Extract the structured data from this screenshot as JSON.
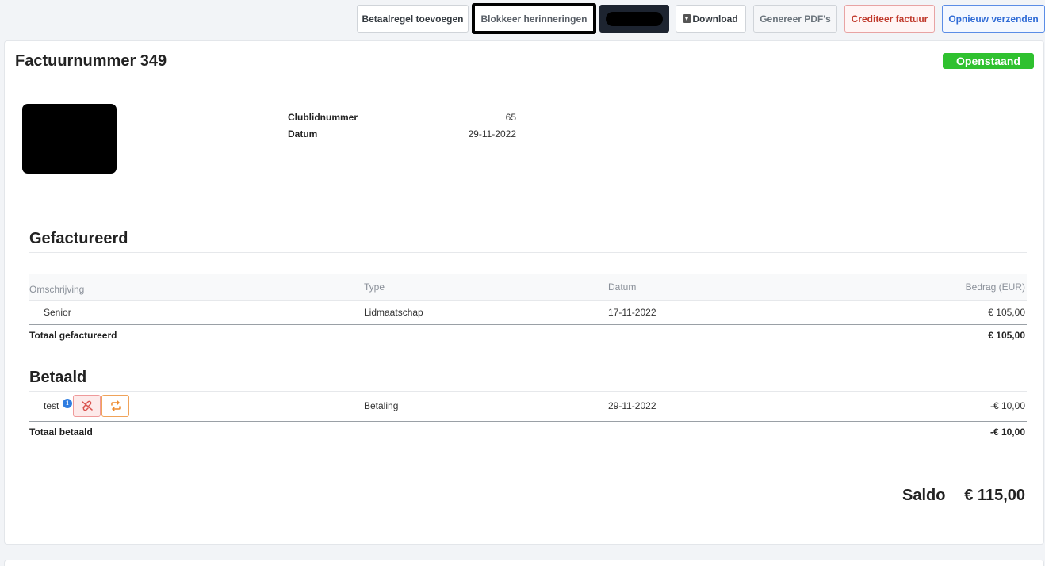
{
  "toolbar": {
    "add_payment_line": "Betaalregel toevoegen",
    "block_reminders": "Blokkeer herinneringen",
    "download": "Download",
    "generate_pdfs": "Genereer PDF's",
    "credit_invoice": "Crediteer factuur",
    "resend": "Opnieuw verzenden"
  },
  "invoice": {
    "title": "Factuurnummer 349",
    "status": "Openstaand",
    "status_color": "#2fc12f",
    "fields": [
      {
        "label": "Clublidnummer",
        "value": "65"
      },
      {
        "label": "Datum",
        "value": "29-11-2022"
      }
    ]
  },
  "billed": {
    "title": "Gefactureerd",
    "columns": [
      "Omschrijving",
      "Type",
      "Datum",
      "Bedrag (EUR)"
    ],
    "rows": [
      {
        "description": "Senior",
        "type": "Lidmaatschap",
        "date": "17-11-2022",
        "amount": "€ 105,00"
      }
    ],
    "total_label": "Totaal gefactureerd",
    "total_value": "€ 105,00"
  },
  "paid": {
    "title": "Betaald",
    "rows": [
      {
        "description": "test",
        "type": "Betaling",
        "date": "29-11-2022",
        "amount": "-€ 10,00"
      }
    ],
    "total_label": "Totaal betaald",
    "total_value": "-€ 10,00"
  },
  "saldo": {
    "label": "Saldo",
    "value": "€ 115,00"
  },
  "icons": {
    "download": "download-icon",
    "info": "info-icon",
    "unlink": "unlink-icon",
    "sync": "sync-icon"
  }
}
